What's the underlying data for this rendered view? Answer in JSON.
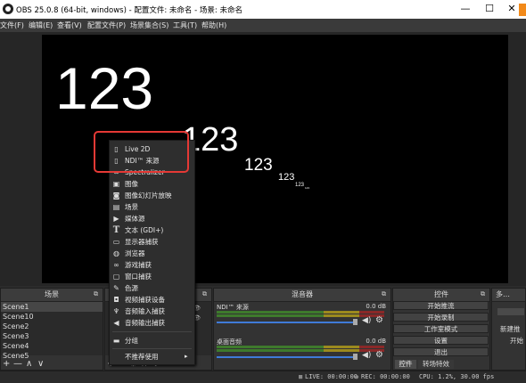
{
  "window": {
    "title": "OBS 25.0.8 (64-bit, windows) - 配置文件: 未命名 - 场景: 未命名",
    "min": "—",
    "max": "☐",
    "close": "✕"
  },
  "menu": [
    "文件(F)",
    "编辑(E)",
    "查看(V)",
    "配置文件(P)",
    "场景集合(S)",
    "工具(T)",
    "帮助(H)"
  ],
  "preview": {
    "texts": [
      "123",
      "123",
      "123",
      "123",
      "123",
      "123"
    ]
  },
  "scenes_dock": {
    "title": "场景",
    "items": [
      "Scene1",
      "Scene10",
      "Scene2",
      "Scene3",
      "Scene4",
      "Scene5"
    ],
    "footer": [
      "+",
      "—",
      "∧",
      "∨"
    ]
  },
  "sources_dock": {
    "footer": [
      "+",
      "—",
      "⚙",
      "∧",
      "∨"
    ]
  },
  "mixer_dock": {
    "title": "混音器",
    "channels": [
      {
        "name": "NDI™ 来源",
        "db": "0.0 dB"
      },
      {
        "name": "桌面音频",
        "db": "0.0 dB"
      }
    ]
  },
  "controls_dock": {
    "title": "控件",
    "buttons": [
      "开始推流",
      "开始录制",
      "工作室模式",
      "设置",
      "退出"
    ],
    "tabs": [
      "控件",
      "转场特效"
    ]
  },
  "extra_dock": {
    "title": "多…",
    "new_label": "新建推",
    "start_label": "开始"
  },
  "status": {
    "live": "LIVE: 00:00:00",
    "rec": "REC: 00:00:00",
    "cpu": "CPU: 1.2%, 30.00 fps"
  },
  "context_menu": {
    "items": [
      {
        "icon": "file-icon",
        "label": "Live 2D"
      },
      {
        "icon": "file-icon",
        "label": "NDI™ 来源"
      },
      {
        "icon": "spectralizer-icon",
        "label": "Spectralizer"
      },
      {
        "icon": "image-icon",
        "label": "图像"
      },
      {
        "icon": "slideshow-icon",
        "label": "图像幻灯片放映"
      },
      {
        "icon": "scene-icon",
        "label": "场景"
      },
      {
        "icon": "media-icon",
        "label": "媒体源"
      },
      {
        "icon": "text-icon",
        "label": "文本 (GDI+)"
      },
      {
        "icon": "monitor-icon",
        "label": "显示器捕获"
      },
      {
        "icon": "globe-icon",
        "label": "浏览器"
      },
      {
        "icon": "gamepad-icon",
        "label": "游戏捕获"
      },
      {
        "icon": "window-icon",
        "label": "窗口捕获"
      },
      {
        "icon": "brush-icon",
        "label": "色源"
      },
      {
        "icon": "camera-icon",
        "label": "视频捕获设备"
      },
      {
        "icon": "mic-icon",
        "label": "音频输入捕获"
      },
      {
        "icon": "speaker-icon",
        "label": "音频输出捕获"
      }
    ],
    "group_label": "分组",
    "deprecated_label": "不推荐使用",
    "deprecated_arrow": "▸"
  },
  "colors": {
    "highlight": "#e53935",
    "fader": "#3f7bd8",
    "orange_tab": "#f28a1a"
  }
}
